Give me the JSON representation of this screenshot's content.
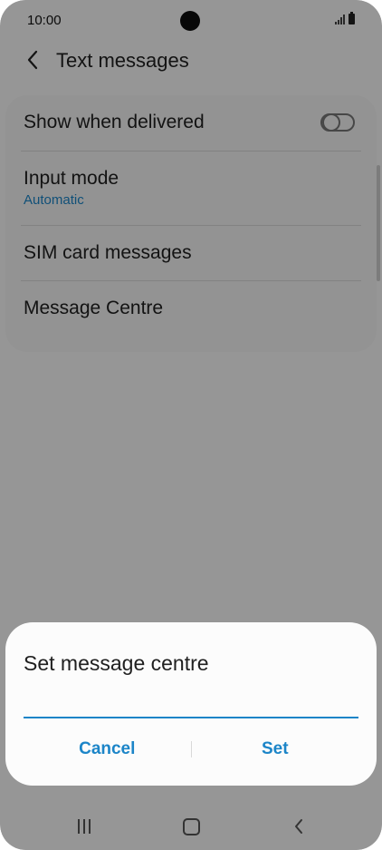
{
  "status_bar": {
    "time": "10:00"
  },
  "header": {
    "title": "Text messages"
  },
  "settings": {
    "show_delivered": {
      "label": "Show when delivered",
      "enabled": false
    },
    "input_mode": {
      "label": "Input mode",
      "value": "Automatic"
    },
    "sim_card_messages": {
      "label": "SIM card messages"
    },
    "message_centre": {
      "label": "Message Centre"
    }
  },
  "dialog": {
    "title": "Set message centre",
    "input_value": "",
    "cancel_label": "Cancel",
    "set_label": "Set"
  },
  "colors": {
    "accent": "#1c85c8",
    "scrim": "#000000"
  },
  "nav": {
    "icons": [
      "recents-icon",
      "home-icon",
      "back-icon"
    ]
  }
}
